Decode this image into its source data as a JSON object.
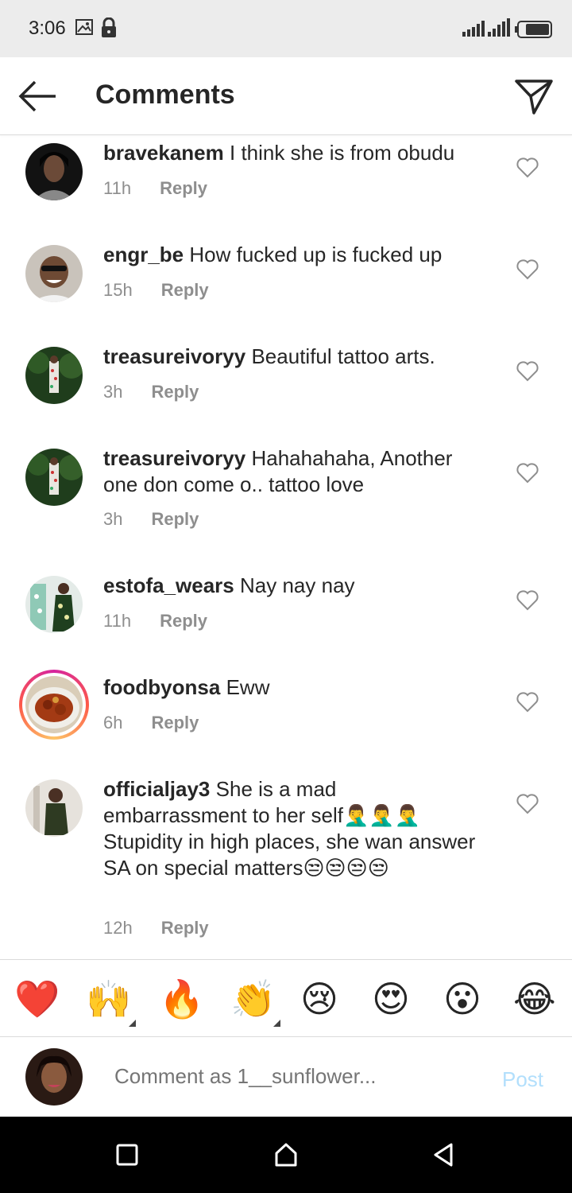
{
  "status_bar": {
    "time": "3:06"
  },
  "header": {
    "title": "Comments"
  },
  "comments": [
    {
      "username": "bravekanem",
      "text": "I think she is from obudu",
      "time": "11h",
      "reply": "Reply"
    },
    {
      "username": "engr_be",
      "text": "How fucked up is fucked up",
      "time": "15h",
      "reply": "Reply"
    },
    {
      "username": "treasureivoryy",
      "text": "Beautiful tattoo arts.",
      "time": "3h",
      "reply": "Reply"
    },
    {
      "username": "treasureivoryy",
      "text": "Hahahahaha, Another one don come o.. tattoo love",
      "time": "3h",
      "reply": "Reply"
    },
    {
      "username": "estofa_wears",
      "text": "Nay nay nay",
      "time": "11h",
      "reply": "Reply"
    },
    {
      "username": "foodbyonsa",
      "text": "Eww",
      "time": "6h",
      "reply": "Reply"
    },
    {
      "username": "officialjay3",
      "text": "She is a mad embarrassment to her self🤦‍♂️🤦‍♂️🤦‍♂️ Stupidity in high places, she wan answer SA on special matters😒😒😒😒",
      "time": "12h",
      "reply": "Reply"
    }
  ],
  "reactions": [
    "❤️",
    "🙌",
    "🔥",
    "👏",
    "😢",
    "😍",
    "😮",
    "😂"
  ],
  "composer": {
    "placeholder": "Comment as 1__sunflower...",
    "post_label": "Post"
  },
  "colors": {
    "post": "#b2dffc",
    "meta": "#8e8e8e",
    "text": "#262626",
    "heart_red": "#ed4956"
  }
}
